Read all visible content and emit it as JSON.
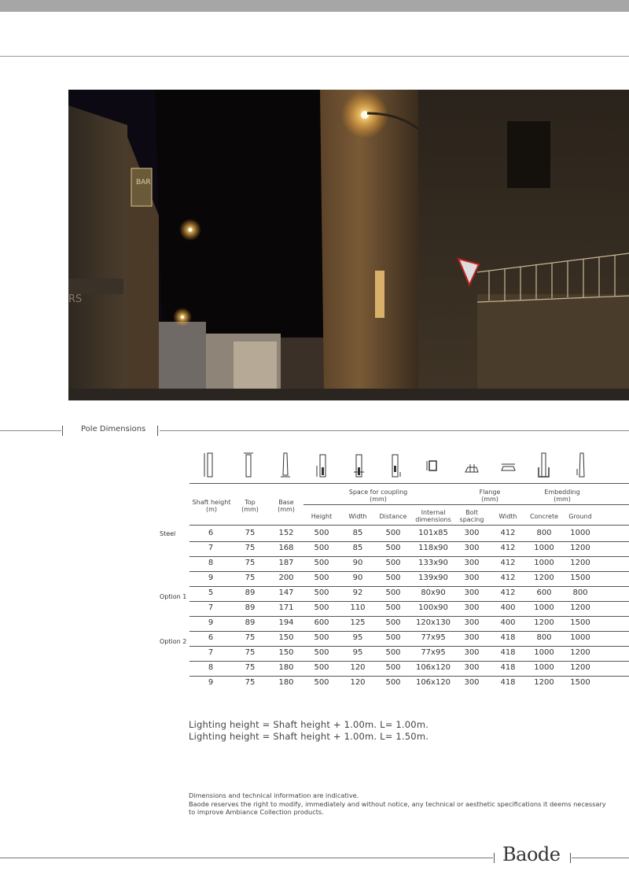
{
  "section": {
    "title": "Pole Dimensions"
  },
  "table": {
    "headers": {
      "shaft_height": [
        "Shaft height",
        "(m)"
      ],
      "top": [
        "Top",
        "(mm)"
      ],
      "base": [
        "Base",
        "(mm)"
      ],
      "space_for_coupling": [
        "Space for coupling",
        "(mm)"
      ],
      "flange": [
        "Flange",
        "(mm)"
      ],
      "embedding": [
        "Embedding",
        "(mm)"
      ],
      "height": "Height",
      "width": "Width",
      "distance": "Distance",
      "internal": [
        "Internal",
        "dimensions"
      ],
      "bolt": [
        "Bolt",
        "spacing"
      ],
      "flange_width": "Width",
      "concrete": "Concrete",
      "ground": "Ground"
    },
    "groups": [
      "Steel",
      "Option 1",
      "Option 2"
    ],
    "rows": [
      [
        "6",
        "75",
        "152",
        "500",
        "85",
        "500",
        "101x85",
        "300",
        "412",
        "800",
        "1000"
      ],
      [
        "7",
        "75",
        "168",
        "500",
        "85",
        "500",
        "118x90",
        "300",
        "412",
        "1000",
        "1200"
      ],
      [
        "8",
        "75",
        "187",
        "500",
        "90",
        "500",
        "133x90",
        "300",
        "412",
        "1000",
        "1200"
      ],
      [
        "9",
        "75",
        "200",
        "500",
        "90",
        "500",
        "139x90",
        "300",
        "412",
        "1200",
        "1500"
      ],
      [
        "5",
        "89",
        "147",
        "500",
        "92",
        "500",
        "80x90",
        "300",
        "412",
        "600",
        "800"
      ],
      [
        "7",
        "89",
        "171",
        "500",
        "110",
        "500",
        "100x90",
        "300",
        "400",
        "1000",
        "1200"
      ],
      [
        "9",
        "89",
        "194",
        "600",
        "125",
        "500",
        "120x130",
        "300",
        "400",
        "1200",
        "1500"
      ],
      [
        "6",
        "75",
        "150",
        "500",
        "95",
        "500",
        "77x95",
        "300",
        "418",
        "800",
        "1000"
      ],
      [
        "7",
        "75",
        "150",
        "500",
        "95",
        "500",
        "77x95",
        "300",
        "418",
        "1000",
        "1200"
      ],
      [
        "8",
        "75",
        "180",
        "500",
        "120",
        "500",
        "106x120",
        "300",
        "418",
        "1000",
        "1200"
      ],
      [
        "9",
        "75",
        "180",
        "500",
        "120",
        "500",
        "106x120",
        "300",
        "418",
        "1200",
        "1500"
      ]
    ]
  },
  "notes": {
    "line1": "Lighting height = Shaft height + 1.00m. L= 1.00m.",
    "line2": "Lighting height = Shaft height + 1.00m. L= 1.50m."
  },
  "disclaimer": {
    "line1": "Dimensions and technical information are indicative.",
    "line2": "Baode reserves the right to modify, immediately and without notice, any technical or aesthetic specifications it deems necessary to improve Ambiance Collection products."
  },
  "footer": {
    "logo": "Baode"
  },
  "photo": {
    "sign_text": "BAR",
    "wall_text": "RS"
  }
}
